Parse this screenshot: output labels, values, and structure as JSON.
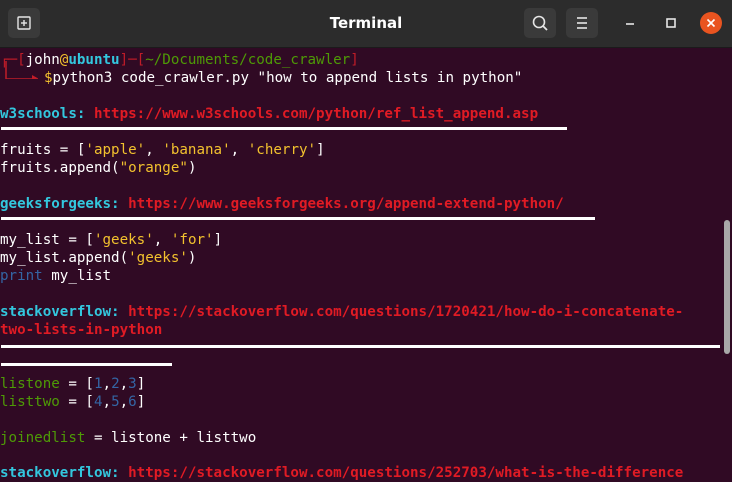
{
  "window": {
    "title": "Terminal"
  },
  "colors": {
    "background": "#300a24",
    "titlebar": "#2c2c2c",
    "close": "#e95420",
    "link_red": "#e01b24",
    "site_cyan": "#33c7de",
    "string_yellow": "#f2c12e",
    "number_blue": "#3465a4",
    "var_green": "#4e9a06"
  },
  "icons": {
    "new_tab": "new-tab-icon",
    "search": "search-icon",
    "menu": "hamburger-menu-icon",
    "minimize": "minimize-icon",
    "maximize": "maximize-icon",
    "close": "close-icon"
  },
  "prompt": {
    "open_bracket": "┌─[",
    "user": "john",
    "at": "@",
    "host": "ubuntu",
    "sep": "]─[",
    "path": "~/Documents/code_crawler",
    "close_bracket": "]",
    "dollar": "$",
    "command": "python3 code_crawler.py \"how to append lists in python\""
  },
  "results": [
    {
      "site": "w3schools:",
      "url": "https://www.w3schools.com/python/ref_list_append.asp"
    },
    {
      "site": "geeksforgeeks:",
      "url": "https://www.geeksforgeeks.org/append-extend-python/"
    },
    {
      "site": "stackoverflow:",
      "url": "https://stackoverflow.com/questions/1720421/how-do-i-concatenate-",
      "url_cont": "two-lists-in-python"
    },
    {
      "site": "stackoverflow:",
      "url": "https://stackoverflow.com/questions/252703/what-is-the-difference"
    }
  ],
  "code": {
    "w3_line1": {
      "pre": "fruits = [",
      "s1": "'apple'",
      "c1": ", ",
      "s2": "'banana'",
      "c2": ", ",
      "s3": "'cherry'",
      "post": "]"
    },
    "w3_line2": {
      "pre": "fruits.append(",
      "s1": "\"orange\"",
      "post": ")"
    },
    "gfg_line1": {
      "pre": "my_list = [",
      "s1": "'geeks'",
      "c1": ", ",
      "s2": "'for'",
      "post": "]"
    },
    "gfg_line2": {
      "pre": "my_list.append(",
      "s1": "'geeks'",
      "post": ")"
    },
    "gfg_line3": {
      "kw": "print",
      "post": " my_list"
    },
    "so_line1": {
      "var": "listone",
      "eq": " = ",
      "open": "[",
      "n1": "1",
      "c1": ",",
      "n2": "2",
      "c2": ",",
      "n3": "3",
      "close": "]"
    },
    "so_line2": {
      "var": "listtwo",
      "eq": " = ",
      "open": "[",
      "n1": "4",
      "c1": ",",
      "n2": "5",
      "c2": ",",
      "n3": "6",
      "close": "]"
    },
    "so_line3": {
      "var": "joinedlist",
      "eq": " = ",
      "post": "listone + listtwo"
    }
  }
}
